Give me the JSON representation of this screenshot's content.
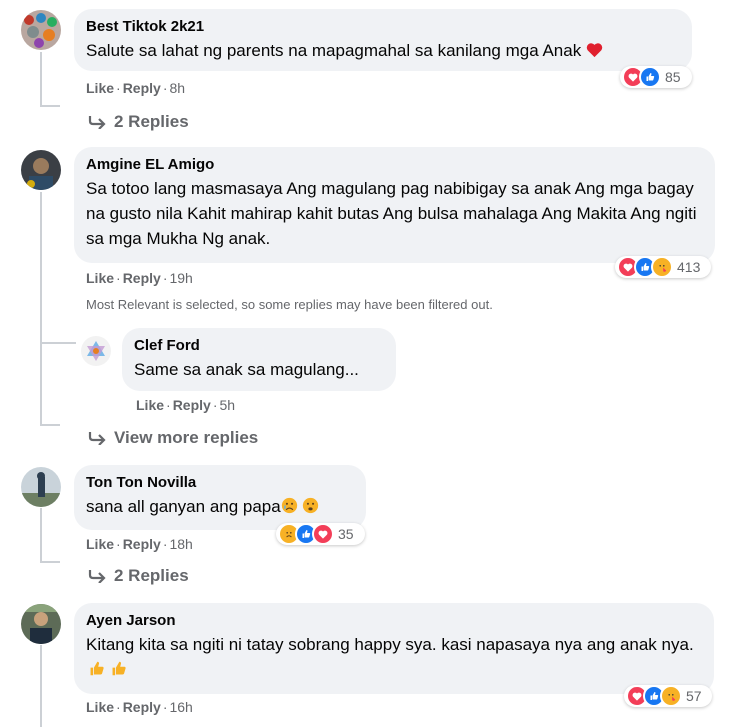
{
  "comments": [
    {
      "name": "Best Tiktok 2k21",
      "text": "Salute sa lahat ng parents na mapagmahal sa kanilang mga Anak",
      "like": "Like",
      "reply": "Reply",
      "time": "8h",
      "reactions_count": "85",
      "replies_label": "2 Replies"
    },
    {
      "name": "Amgine EL Amigo",
      "text": "Sa totoo lang masmasaya Ang magulang pag nabibigay sa anak Ang mga bagay na gusto nila Kahit mahirap kahit butas Ang bulsa mahalaga Ang Makita Ang ngiti sa mga Mukha Ng anak.",
      "like": "Like",
      "reply": "Reply",
      "time": "19h",
      "reactions_count": "413",
      "notice": "Most Relevant is selected, so some replies may have been filtered out.",
      "reply_item": {
        "name": "Clef Ford",
        "text": "Same sa anak sa magulang...",
        "like": "Like",
        "reply": "Reply",
        "time": "5h"
      },
      "replies_label": "View more replies"
    },
    {
      "name": "Ton Ton Novilla",
      "text": "sana all ganyan ang papa",
      "like": "Like",
      "reply": "Reply",
      "time": "18h",
      "reactions_count": "35",
      "replies_label": "2 Replies"
    },
    {
      "name": "Ayen Jarson",
      "text": "Kitang kita sa ngiti ni tatay sobrang happy sya. kasi napasaya nya ang anak nya.",
      "like": "Like",
      "reply": "Reply",
      "time": "16h",
      "reactions_count": "57"
    }
  ],
  "colors": {
    "bubble": "#f0f2f5",
    "meta": "#65676b",
    "love": "#f33e58",
    "like": "#1877f2",
    "haha": "#f7b125"
  }
}
